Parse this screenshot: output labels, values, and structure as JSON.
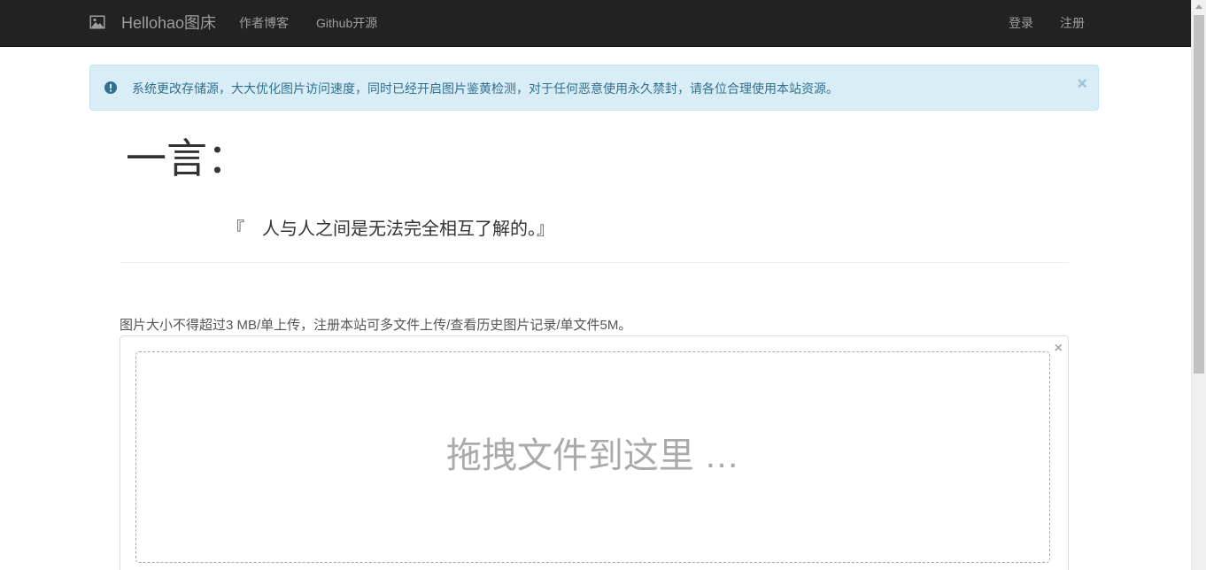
{
  "navbar": {
    "brand": "Hellohao图床",
    "brand_icon": "image-icon",
    "links": [
      "作者博客",
      "Github开源"
    ],
    "right_links": [
      "登录",
      "注册"
    ]
  },
  "alert": {
    "icon": "exclamation-circle-icon",
    "text": "系统更改存储源，大大优化图片访问速度，同时已经开启图片鉴黄检测，对于任何恶意使用永久禁封，请各位合理使用本站资源。",
    "close": "×"
  },
  "hitokoto": {
    "heading": "一言：",
    "quote": "『　人与人之间是无法完全相互了解的。』"
  },
  "upload": {
    "notice": "图片大小不得超过3 MB/单上传，注册本站可多文件上传/查看历史图片记录/单文件5M。",
    "close": "×",
    "drop_text": "拖拽文件到这里 …"
  },
  "colors": {
    "navbar_bg": "#222222",
    "alert_bg": "#d9edf7",
    "alert_text": "#31708f"
  }
}
